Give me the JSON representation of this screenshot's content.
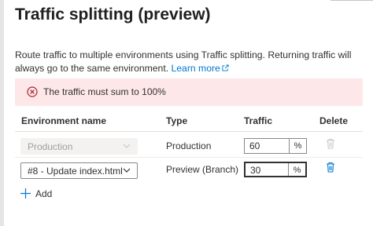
{
  "panel": {
    "title": "Traffic splitting (preview)",
    "description": "Route traffic to multiple environments using Traffic splitting. Returning traffic will always go to the same environment.",
    "learn_more": "Learn more",
    "error_message": "The traffic must sum to 100%"
  },
  "table": {
    "headers": {
      "environment": "Environment name",
      "type": "Type",
      "traffic": "Traffic",
      "delete": "Delete"
    },
    "rows": [
      {
        "environment": "Production",
        "type": "Production",
        "traffic": "60",
        "unit": "%",
        "disabled": true
      },
      {
        "environment": "#8 - Update index.html",
        "type": "Preview (Branch)",
        "traffic": "30",
        "unit": "%",
        "disabled": false
      }
    ]
  },
  "add_label": "Add",
  "colors": {
    "accent": "#0078d4",
    "error": "#a4262c",
    "error_bg": "#fde7e9"
  }
}
